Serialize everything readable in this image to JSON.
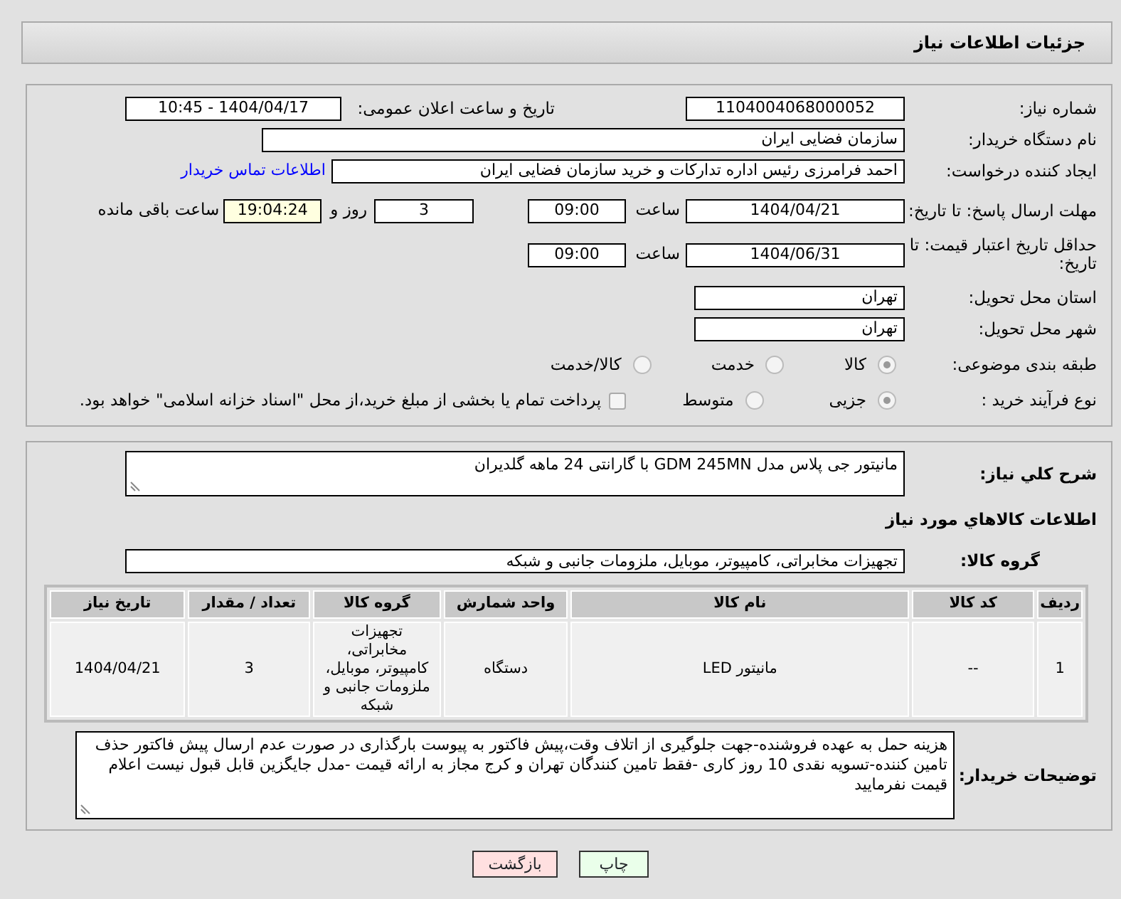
{
  "header": {
    "title": "جزئیات اطلاعات نیاز"
  },
  "need_number": {
    "label": "شماره نیاز:",
    "value": "1104004068000052"
  },
  "announce": {
    "label": "تاریخ و ساعت اعلان عمومی:",
    "value": "1404/04/17 - 10:45"
  },
  "buyer_org": {
    "label": "نام دستگاه خریدار:",
    "value": "سازمان فضایی ایران"
  },
  "requester": {
    "label": "ایجاد کننده درخواست:",
    "value": "احمد فرامرزی رئیس اداره تدارکات و خرید سازمان فضایی ایران",
    "contact_link": "اطلاعات تماس خریدار"
  },
  "reply_deadline": {
    "label": "مهلت ارسال پاسخ: تا تاریخ:",
    "date": "1404/04/21",
    "time_label": "ساعت",
    "time": "09:00",
    "days": "3",
    "days_label": "روز و",
    "remaining": "19:04:24",
    "remaining_label": "ساعت باقی مانده"
  },
  "price_validity": {
    "label": "حداقل تاریخ اعتبار قیمت: تا تاریخ:",
    "date": "1404/06/31",
    "time_label": "ساعت",
    "time": "09:00"
  },
  "province": {
    "label": "استان محل تحویل:",
    "value": "تهران"
  },
  "city": {
    "label": "شهر محل تحویل:",
    "value": "تهران"
  },
  "category": {
    "label": "طبقه بندی موضوعی:",
    "options": [
      {
        "label": "کالا",
        "selected": true
      },
      {
        "label": "خدمت",
        "selected": false
      },
      {
        "label": "کالا/خدمت",
        "selected": false
      }
    ]
  },
  "process": {
    "label": "نوع فرآیند خرید :",
    "options": [
      {
        "label": "جزیی",
        "selected": true
      },
      {
        "label": "متوسط",
        "selected": false
      }
    ],
    "treasury": {
      "checked": false,
      "text": "پرداخت تمام یا بخشی از مبلغ خرید،از محل \"اسناد خزانه اسلامی\" خواهد بود."
    }
  },
  "description": {
    "label": "شرح کلي نياز:",
    "value": "مانیتور جی پلاس مدل GDM 245MN با گارانتی 24 ماهه گلدیران"
  },
  "goods_title": "اطلاعات کالاهاي مورد نياز",
  "goods_group": {
    "label": "گروه کالا:",
    "value": "تجهیزات مخابراتی، کامپیوتر، موبایل، ملزومات جانبی و شبکه"
  },
  "table": {
    "columns": [
      "ردیف",
      "کد کالا",
      "نام کالا",
      "واحد شمارش",
      "گروه کالا",
      "تعداد / مقدار",
      "تاریخ نیاز"
    ],
    "rows": [
      [
        "1",
        "--",
        "مانیتور LED",
        "دستگاه",
        "تجهیزات مخابراتی، کامپیوتر، موبایل، ملزومات جانبی و شبکه",
        "3",
        "1404/04/21"
      ]
    ]
  },
  "buyer_notes": {
    "label": "توضیحات خریدار:",
    "value": "هزینه حمل به عهده فروشنده-جهت جلوگیری از اتلاف وقت،پیش فاکتور به پیوست بارگذاری در صورت عدم ارسال پیش فاکتور حذف تامین کننده-تسویه نقدی 10 روز کاری -فقط تامین کنندگان تهران و کرج مجاز به ارائه قیمت -مدل جایگزین قابل قبول نیست اعلام قیمت نفرمایید"
  },
  "buttons": [
    {
      "label": "چاپ",
      "kind": "print"
    },
    {
      "label": "بازگشت",
      "kind": "back"
    }
  ]
}
